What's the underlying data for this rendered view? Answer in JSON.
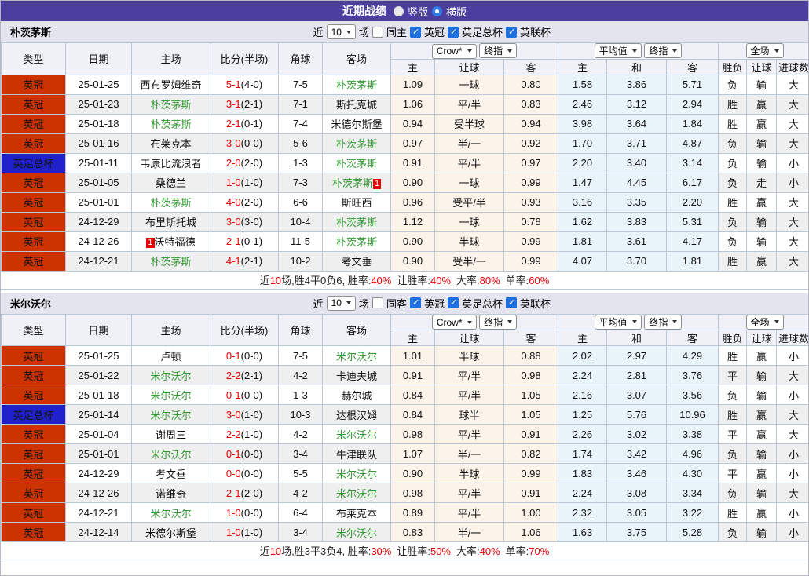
{
  "title_bar": {
    "title": "近期战绩",
    "layout_options": [
      {
        "label": "竖版",
        "selected": false
      },
      {
        "label": "横版",
        "selected": true
      }
    ]
  },
  "controls_labels": {
    "near": "近",
    "games": "场"
  },
  "table_header": {
    "type": "类型",
    "date": "日期",
    "home": "主场",
    "score": "比分(半场)",
    "corners": "角球",
    "away": "客场",
    "odds_home": "主",
    "odds_handicap": "让球",
    "odds_away": "客",
    "avg_home": "主",
    "avg_draw": "和",
    "avg_away": "客",
    "result_wdl": "胜负",
    "result_handicap": "让球",
    "result_goals": "进球数"
  },
  "colors": {
    "header_purple": "#4a3f9e",
    "league_championship": "#cc3300",
    "league_fa_cup": "#2121cc",
    "self_team_green": "#339933",
    "score_red": "#e60000",
    "win_red": "#e60000",
    "draw_green": "#339933",
    "lose_blue": "#2222cc",
    "odds_bg": "#fcf4ea",
    "avg_bg": "#e9f4fa"
  },
  "sections": [
    {
      "team": "朴茨茅斯",
      "controls": {
        "games_count": "10",
        "same_label": "同主",
        "same_checked": false,
        "leagues": [
          {
            "label": "英冠",
            "checked": true
          },
          {
            "label": "英足总杯",
            "checked": true
          },
          {
            "label": "英联杯",
            "checked": true
          }
        ],
        "odds_company": "Crow*",
        "odds_time": "终指",
        "avg_source": "平均值",
        "avg_time": "终指",
        "scope": "全场"
      },
      "rows": [
        {
          "type": "英冠",
          "date": "25-01-25",
          "home": "西布罗姆维奇",
          "ft": "5-1",
          "ht": "4-0",
          "corners": "7-5",
          "away": "朴茨茅斯",
          "odds": [
            "1.09",
            "一球",
            "0.80"
          ],
          "avg": [
            "1.58",
            "3.86",
            "5.71"
          ],
          "results": [
            "负",
            "输",
            "大"
          ]
        },
        {
          "type": "英冠",
          "date": "25-01-23",
          "home": "朴茨茅斯",
          "ft": "3-1",
          "ht": "2-1",
          "corners": "7-1",
          "away": "斯托克城",
          "odds": [
            "1.06",
            "平/半",
            "0.83"
          ],
          "avg": [
            "2.46",
            "3.12",
            "2.94"
          ],
          "results": [
            "胜",
            "赢",
            "大"
          ]
        },
        {
          "type": "英冠",
          "date": "25-01-18",
          "home": "朴茨茅斯",
          "ft": "2-1",
          "ht": "0-1",
          "corners": "7-4",
          "away": "米德尔斯堡",
          "odds": [
            "0.94",
            "受半球",
            "0.94"
          ],
          "avg": [
            "3.98",
            "3.64",
            "1.84"
          ],
          "results": [
            "胜",
            "赢",
            "大"
          ]
        },
        {
          "type": "英冠",
          "date": "25-01-16",
          "home": "布莱克本",
          "ft": "3-0",
          "ht": "0-0",
          "corners": "5-6",
          "away": "朴茨茅斯",
          "odds": [
            "0.97",
            "半/一",
            "0.92"
          ],
          "avg": [
            "1.70",
            "3.71",
            "4.87"
          ],
          "results": [
            "负",
            "输",
            "大"
          ]
        },
        {
          "type": "英足总杯",
          "date": "25-01-11",
          "home": "韦康比流浪者",
          "ft": "2-0",
          "ht": "2-0",
          "corners": "1-3",
          "away": "朴茨茅斯",
          "odds": [
            "0.91",
            "平/半",
            "0.97"
          ],
          "avg": [
            "2.20",
            "3.40",
            "3.14"
          ],
          "results": [
            "负",
            "输",
            "小"
          ]
        },
        {
          "type": "英冠",
          "date": "25-01-05",
          "home": "桑德兰",
          "ft": "1-0",
          "ht": "1-0",
          "corners": "7-3",
          "away": "朴茨茅斯",
          "away_badge_post": "1",
          "odds": [
            "0.90",
            "一球",
            "0.99"
          ],
          "avg": [
            "1.47",
            "4.45",
            "6.17"
          ],
          "results": [
            "负",
            "走",
            "小"
          ]
        },
        {
          "type": "英冠",
          "date": "25-01-01",
          "home": "朴茨茅斯",
          "ft": "4-0",
          "ht": "2-0",
          "corners": "6-6",
          "away": "斯旺西",
          "odds": [
            "0.96",
            "受平/半",
            "0.93"
          ],
          "avg": [
            "3.16",
            "3.35",
            "2.20"
          ],
          "results": [
            "胜",
            "赢",
            "大"
          ]
        },
        {
          "type": "英冠",
          "date": "24-12-29",
          "home": "布里斯托城",
          "ft": "3-0",
          "ht": "3-0",
          "corners": "10-4",
          "away": "朴茨茅斯",
          "odds": [
            "1.12",
            "一球",
            "0.78"
          ],
          "avg": [
            "1.62",
            "3.83",
            "5.31"
          ],
          "results": [
            "负",
            "输",
            "大"
          ]
        },
        {
          "type": "英冠",
          "date": "24-12-26",
          "home": "沃特福德",
          "home_badge_pre": "1",
          "ft": "2-1",
          "ht": "0-1",
          "corners": "11-5",
          "away": "朴茨茅斯",
          "odds": [
            "0.90",
            "半球",
            "0.99"
          ],
          "avg": [
            "1.81",
            "3.61",
            "4.17"
          ],
          "results": [
            "负",
            "输",
            "大"
          ]
        },
        {
          "type": "英冠",
          "date": "24-12-21",
          "home": "朴茨茅斯",
          "ft": "4-1",
          "ht": "2-1",
          "corners": "10-2",
          "away": "考文垂",
          "odds": [
            "0.90",
            "受半/一",
            "0.99"
          ],
          "avg": [
            "4.07",
            "3.70",
            "1.81"
          ],
          "results": [
            "胜",
            "赢",
            "大"
          ]
        }
      ],
      "summary": {
        "pre": "近",
        "games": "10",
        "mid": "场,胜4平0负6, 胜率:",
        "win_rate": "40%",
        "hcap_label": "让胜率:",
        "hcap_rate": "40%",
        "big_label": "大率:",
        "big_rate": "80%",
        "single_label": "单率:",
        "single_rate": "60%"
      }
    },
    {
      "team": "米尔沃尔",
      "controls": {
        "games_count": "10",
        "same_label": "同客",
        "same_checked": false,
        "leagues": [
          {
            "label": "英冠",
            "checked": true
          },
          {
            "label": "英足总杯",
            "checked": true
          },
          {
            "label": "英联杯",
            "checked": true
          }
        ],
        "odds_company": "Crow*",
        "odds_time": "终指",
        "avg_source": "平均值",
        "avg_time": "终指",
        "scope": "全场"
      },
      "rows": [
        {
          "type": "英冠",
          "date": "25-01-25",
          "home": "卢顿",
          "ft": "0-1",
          "ht": "0-0",
          "corners": "7-5",
          "away": "米尔沃尔",
          "odds": [
            "1.01",
            "半球",
            "0.88"
          ],
          "avg": [
            "2.02",
            "2.97",
            "4.29"
          ],
          "results": [
            "胜",
            "赢",
            "小"
          ]
        },
        {
          "type": "英冠",
          "date": "25-01-22",
          "home": "米尔沃尔",
          "ft": "2-2",
          "ht": "2-1",
          "corners": "4-2",
          "away": "卡迪夫城",
          "odds": [
            "0.91",
            "平/半",
            "0.98"
          ],
          "avg": [
            "2.24",
            "2.81",
            "3.76"
          ],
          "results": [
            "平",
            "输",
            "大"
          ]
        },
        {
          "type": "英冠",
          "date": "25-01-18",
          "home": "米尔沃尔",
          "ft": "0-1",
          "ht": "0-0",
          "corners": "1-3",
          "away": "赫尔城",
          "odds": [
            "0.84",
            "平/半",
            "1.05"
          ],
          "avg": [
            "2.16",
            "3.07",
            "3.56"
          ],
          "results": [
            "负",
            "输",
            "小"
          ]
        },
        {
          "type": "英足总杯",
          "date": "25-01-14",
          "home": "米尔沃尔",
          "ft": "3-0",
          "ht": "1-0",
          "corners": "10-3",
          "away": "达根汉姆",
          "odds": [
            "0.84",
            "球半",
            "1.05"
          ],
          "avg": [
            "1.25",
            "5.76",
            "10.96"
          ],
          "results": [
            "胜",
            "赢",
            "大"
          ]
        },
        {
          "type": "英冠",
          "date": "25-01-04",
          "home": "谢周三",
          "ft": "2-2",
          "ht": "1-0",
          "corners": "4-2",
          "away": "米尔沃尔",
          "odds": [
            "0.98",
            "平/半",
            "0.91"
          ],
          "avg": [
            "2.26",
            "3.02",
            "3.38"
          ],
          "results": [
            "平",
            "赢",
            "大"
          ]
        },
        {
          "type": "英冠",
          "date": "25-01-01",
          "home": "米尔沃尔",
          "ft": "0-1",
          "ht": "0-0",
          "corners": "3-4",
          "away": "牛津联队",
          "odds": [
            "1.07",
            "半/一",
            "0.82"
          ],
          "avg": [
            "1.74",
            "3.42",
            "4.96"
          ],
          "results": [
            "负",
            "输",
            "小"
          ]
        },
        {
          "type": "英冠",
          "date": "24-12-29",
          "home": "考文垂",
          "ft": "0-0",
          "ht": "0-0",
          "corners": "5-5",
          "away": "米尔沃尔",
          "odds": [
            "0.90",
            "半球",
            "0.99"
          ],
          "avg": [
            "1.83",
            "3.46",
            "4.30"
          ],
          "results": [
            "平",
            "赢",
            "小"
          ]
        },
        {
          "type": "英冠",
          "date": "24-12-26",
          "home": "诺维奇",
          "ft": "2-1",
          "ht": "2-0",
          "corners": "4-2",
          "away": "米尔沃尔",
          "odds": [
            "0.98",
            "平/半",
            "0.91"
          ],
          "avg": [
            "2.24",
            "3.08",
            "3.34"
          ],
          "results": [
            "负",
            "输",
            "大"
          ]
        },
        {
          "type": "英冠",
          "date": "24-12-21",
          "home": "米尔沃尔",
          "ft": "1-0",
          "ht": "0-0",
          "corners": "6-4",
          "away": "布莱克本",
          "odds": [
            "0.89",
            "平/半",
            "1.00"
          ],
          "avg": [
            "2.32",
            "3.05",
            "3.22"
          ],
          "results": [
            "胜",
            "赢",
            "小"
          ]
        },
        {
          "type": "英冠",
          "date": "24-12-14",
          "home": "米德尔斯堡",
          "ft": "1-0",
          "ht": "1-0",
          "corners": "3-4",
          "away": "米尔沃尔",
          "odds": [
            "0.83",
            "半/一",
            "1.06"
          ],
          "avg": [
            "1.63",
            "3.75",
            "5.28"
          ],
          "results": [
            "负",
            "输",
            "小"
          ]
        }
      ],
      "summary": {
        "pre": "近",
        "games": "10",
        "mid": "场,胜3平3负4, 胜率:",
        "win_rate": "30%",
        "hcap_label": "让胜率:",
        "hcap_rate": "50%",
        "big_label": "大率:",
        "big_rate": "40%",
        "single_label": "单率:",
        "single_rate": "70%"
      }
    }
  ]
}
